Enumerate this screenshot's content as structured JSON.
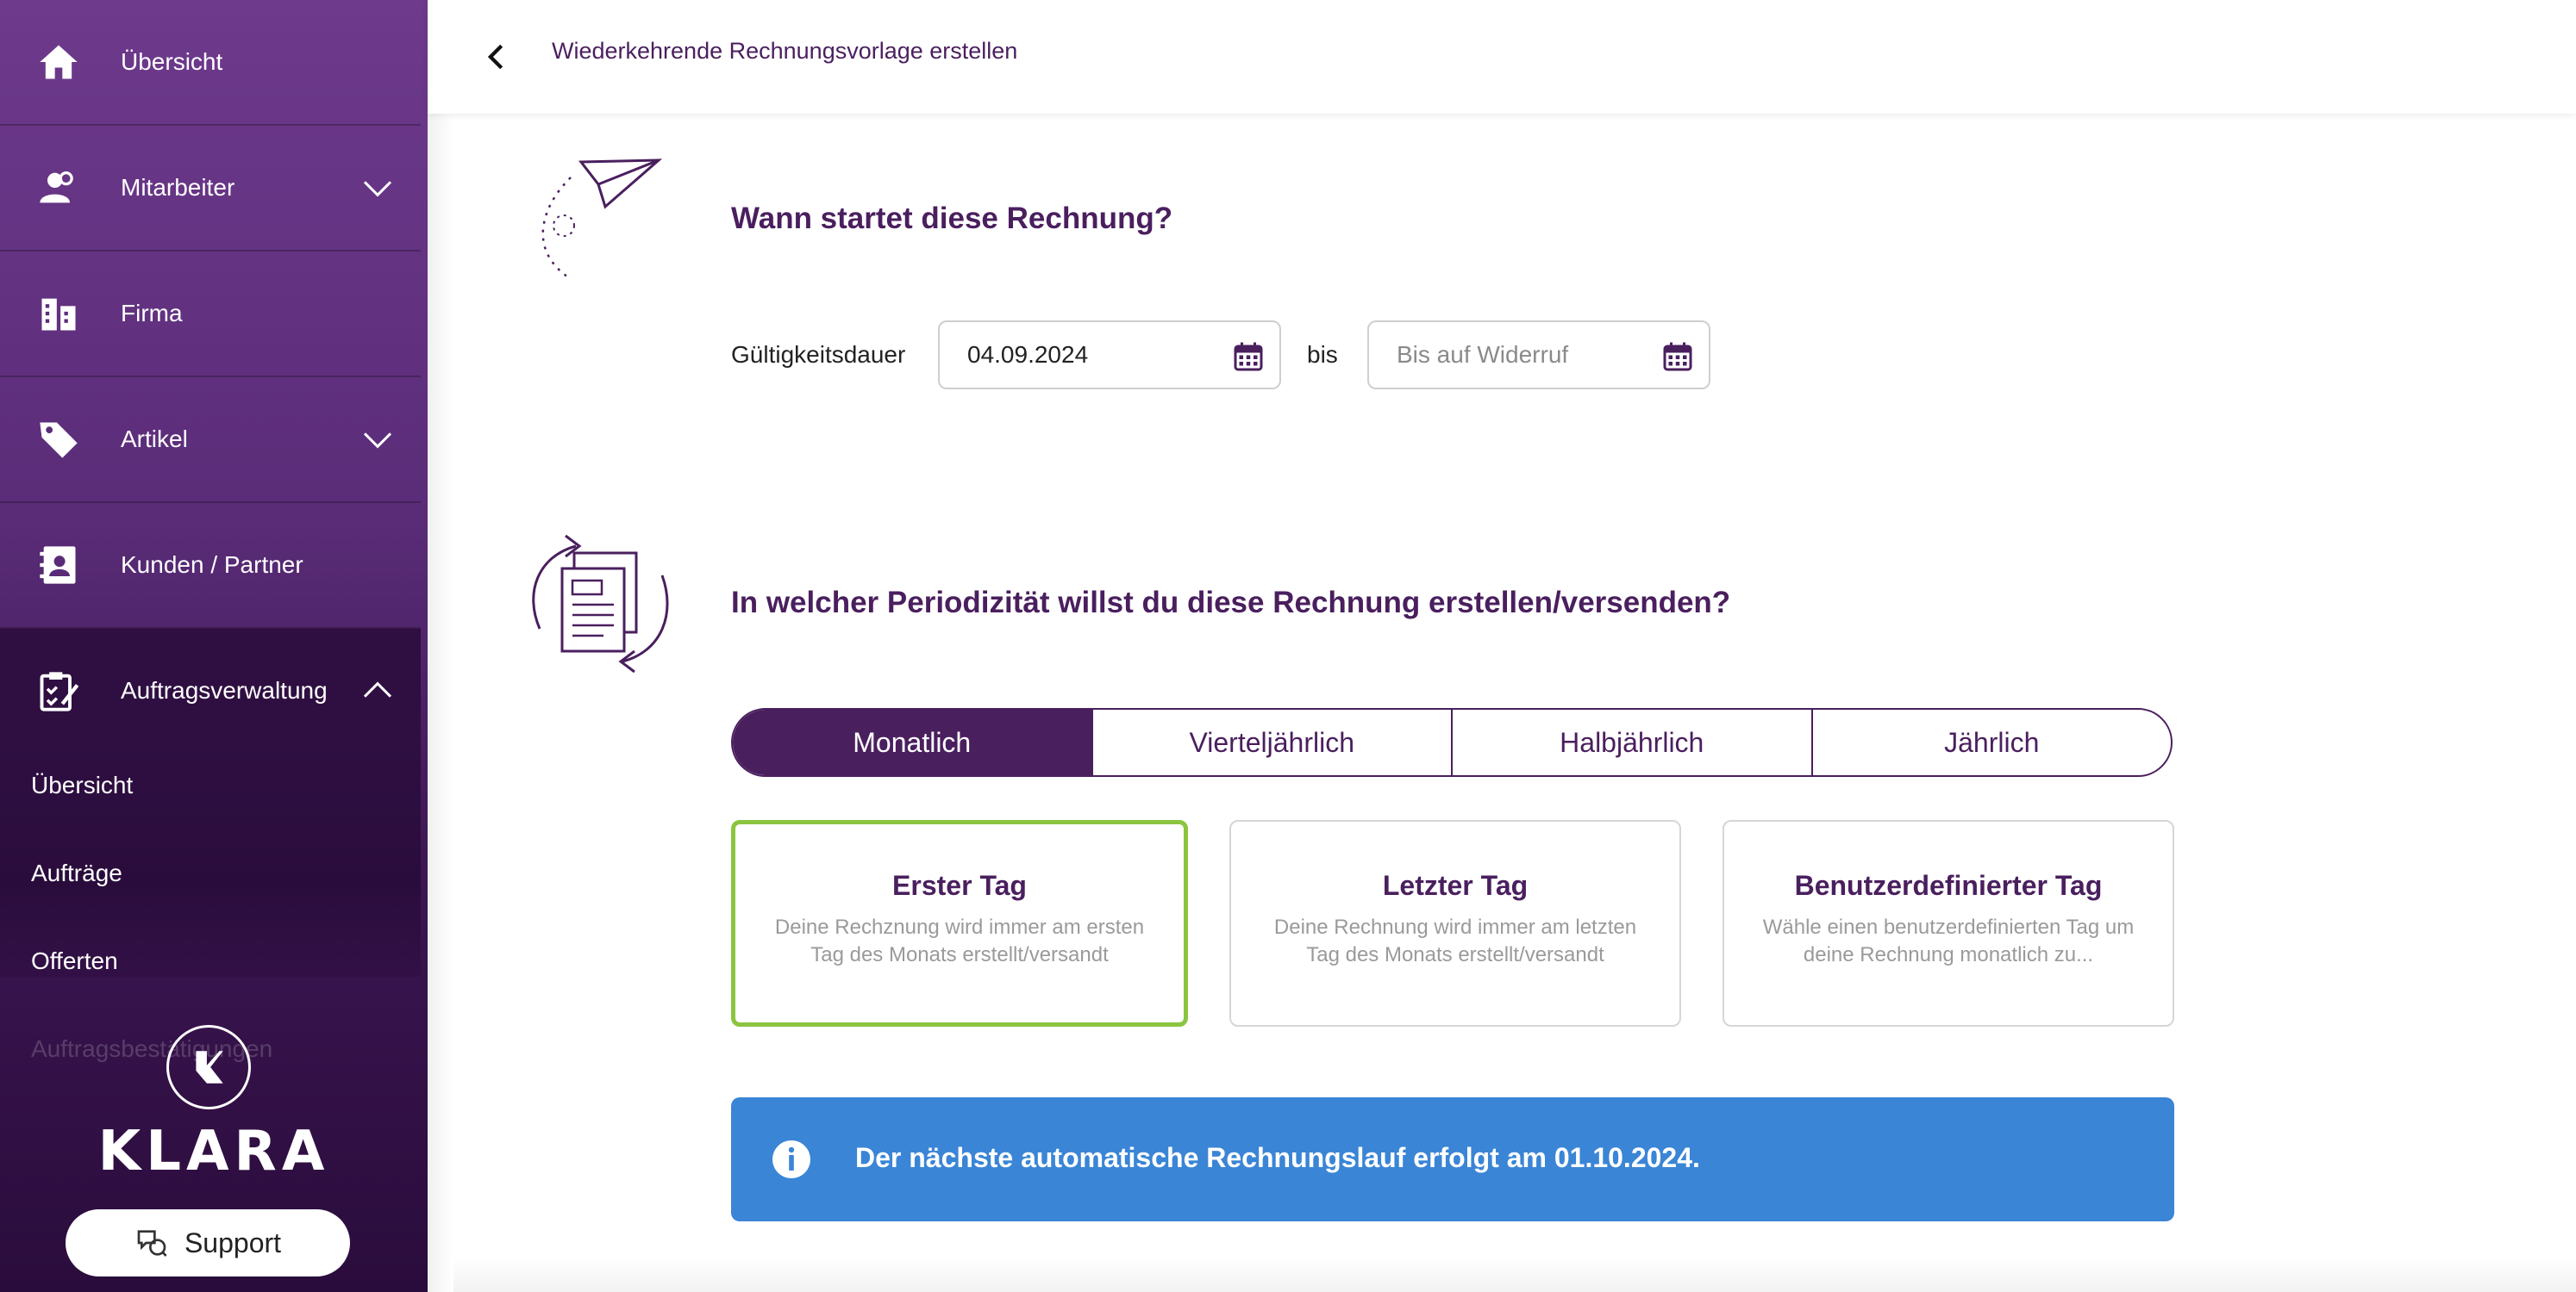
{
  "sidebar": {
    "items": [
      {
        "label": "Übersicht",
        "icon": "home-icon"
      },
      {
        "label": "Mitarbeiter",
        "icon": "users-icon"
      },
      {
        "label": "Firma",
        "icon": "building-icon"
      },
      {
        "label": "Artikel",
        "icon": "tag-icon"
      },
      {
        "label": "Kunden / Partner",
        "icon": "contacts-icon"
      },
      {
        "label": "Auftragsverwaltung",
        "icon": "clipboard-check-icon"
      }
    ],
    "subitems": [
      {
        "label": "Übersicht"
      },
      {
        "label": "Aufträge"
      },
      {
        "label": "Offerten"
      },
      {
        "label": "Auftragsbestätigungen"
      }
    ],
    "brand": "KLARA",
    "support_label": "Support"
  },
  "header": {
    "title": "Wiederkehrende Rechnungsvorlage erstellen"
  },
  "start_section": {
    "title": "Wann startet diese Rechnung?",
    "validity_label": "Gültigkeitsdauer",
    "start_date": "04.09.2024",
    "until_label": "bis",
    "end_placeholder": "Bis auf Widerruf"
  },
  "period_section": {
    "title": "In welcher Periodizität willst du diese Rechnung erstellen/versenden?",
    "options": [
      {
        "label": "Monatlich",
        "selected": true
      },
      {
        "label": "Vierteljährlich",
        "selected": false
      },
      {
        "label": "Halbjährlich",
        "selected": false
      },
      {
        "label": "Jährlich",
        "selected": false
      }
    ],
    "cards": [
      {
        "title": "Erster Tag",
        "desc": "Deine Rechznung wird immer am ersten Tag des Monats erstellt/versandt",
        "selected": true
      },
      {
        "title": "Letzter Tag",
        "desc": "Deine Rechnung wird immer am letzten Tag des Monats erstellt/versandt",
        "selected": false
      },
      {
        "title": "Benutzerdefinierter Tag",
        "desc": "Wähle einen benutzerdefinierten Tag um deine Rechnung monatlich zu...",
        "selected": false
      }
    ]
  },
  "info": {
    "text": "Der nächste automatische Rechnungslauf erfolgt am 01.10.2024."
  },
  "colors": {
    "primary": "#4a1f5e",
    "selected_border": "#8bc53f",
    "info_bg": "#3a85d6"
  }
}
